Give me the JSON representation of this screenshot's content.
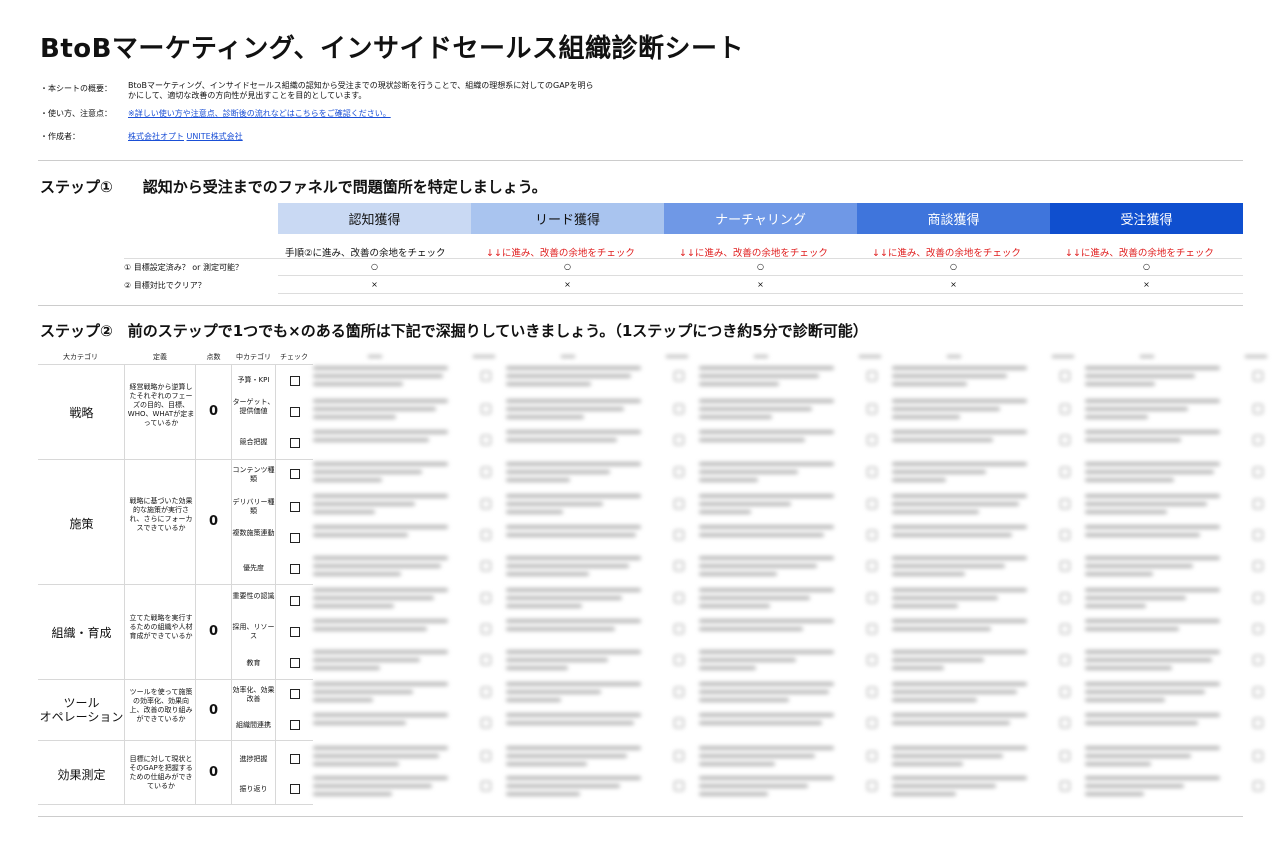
{
  "title": "BtoBマーケティング、インサイドセールス組織診断シート",
  "meta": {
    "overview_label": "・本シートの概要：",
    "overview_line1": "BtoBマーケティング、インサイドセールス組織の認知から受注までの現状診断を行うことで、組織の理想系に対してのGAPを明ら",
    "overview_line2": "かにして、適切な改善の方向性が見出すことを目的としています。",
    "usage_label": "・使い方、注意点：",
    "usage_link": "※詳しい使い方や注意点、診断後の流れなどはこちらをご確認ください。",
    "author_label": "・作成者：",
    "author1": "株式会社オプト",
    "author2": "UNITE株式会社"
  },
  "step1": {
    "title": "ステップ①　　認知から受注までのファネルで問題箇所を特定しましょう。",
    "stages": [
      "認知獲得",
      "リード獲得",
      "ナーチャリング",
      "商談獲得",
      "受注獲得"
    ],
    "stage_colors": [
      "#c9d9f3",
      "#a9c4ef",
      "#6f98e6",
      "#3f75dc",
      "#0f4fcf"
    ],
    "notes": [
      "手順②に進み、改善の余地をチェック",
      "↓↓に進み、改善の余地をチェック",
      "↓↓に進み、改善の余地をチェック",
      "↓↓に進み、改善の余地をチェック",
      "↓↓に進み、改善の余地をチェック"
    ],
    "row1_label": "① 目標設定済み？ or 測定可能？",
    "row2_label": "② 目標対比でクリア？",
    "row1_marks": [
      "○",
      "○",
      "○",
      "○",
      "○"
    ],
    "row2_marks": [
      "×",
      "×",
      "×",
      "×",
      "×"
    ]
  },
  "step2": {
    "title": "ステップ②　前のステップで1つでも×のある箇所は下記で深掘りしていきましょう。（1ステップにつき約5分で診断可能）",
    "headers": {
      "category": "大カテゴリ",
      "definition": "定義",
      "score": "点数",
      "mid": "中カテゴリ",
      "check": "チェック"
    },
    "categories": [
      {
        "name": "戦略",
        "definition": "経営戦略から逆算したそれぞれのフェーズの目的、目標、WHO、WHATが定まっているか",
        "score": "0",
        "subs": [
          "予算・KPI",
          "ターゲット、提供価値",
          "競合把握"
        ]
      },
      {
        "name": "施策",
        "definition": "戦略に基づいた効果的な施策が実行され、さらにフォーカスできているか",
        "score": "0",
        "subs": [
          "コンテンツ種類",
          "デリバリー種類",
          "複数施策連動",
          "優先度"
        ]
      },
      {
        "name": "組織・育成",
        "definition": "立てた戦略を実行するための組織や人材育成ができているか",
        "score": "0",
        "subs": [
          "重要性の認識",
          "採用、リソース",
          "教育"
        ]
      },
      {
        "name": "ツールオペレーション",
        "name_line1": "ツール",
        "name_line2": "オペレーション",
        "definition": "ツールを使って施策の効率化、効果向上、改善の取り組みができているか",
        "score": "0",
        "subs": [
          "効率化、効果改善",
          "組織間連携"
        ]
      },
      {
        "name": "効果測定",
        "definition": "目標に対して現状とそのGAPを把握するための仕組みができているか",
        "score": "0",
        "subs": [
          "進捗把握",
          "振り返り"
        ]
      }
    ]
  }
}
